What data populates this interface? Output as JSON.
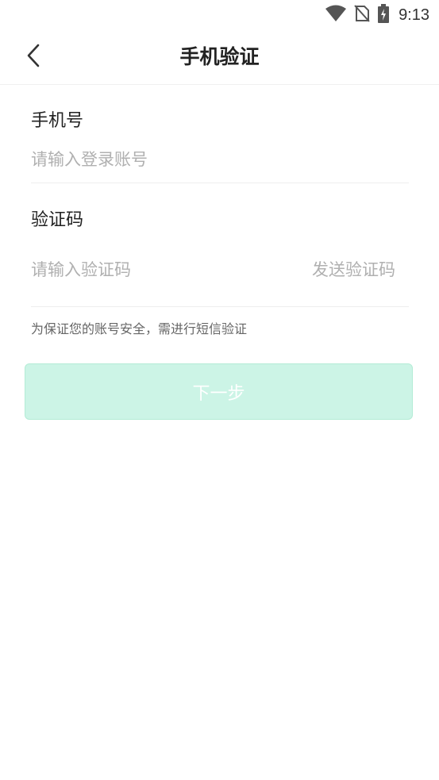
{
  "status_bar": {
    "time": "9:13",
    "icons": [
      "wifi-icon",
      "no-sim-icon",
      "battery-charging-icon"
    ]
  },
  "nav": {
    "title": "手机验证",
    "back_icon": "chevron-left-icon"
  },
  "phone": {
    "label": "手机号",
    "placeholder": "请输入登录账号",
    "value": ""
  },
  "code": {
    "label": "验证码",
    "placeholder": "请输入验证码",
    "value": "",
    "send_label": "发送验证码"
  },
  "hint": "为保证您的账号安全，需进行短信验证",
  "next_button": {
    "label": "下一步"
  },
  "colors": {
    "button_bg": "#ccf4e6",
    "button_text": "#ffffff",
    "placeholder": "#b0b0b0",
    "divider": "#eeeeee"
  }
}
